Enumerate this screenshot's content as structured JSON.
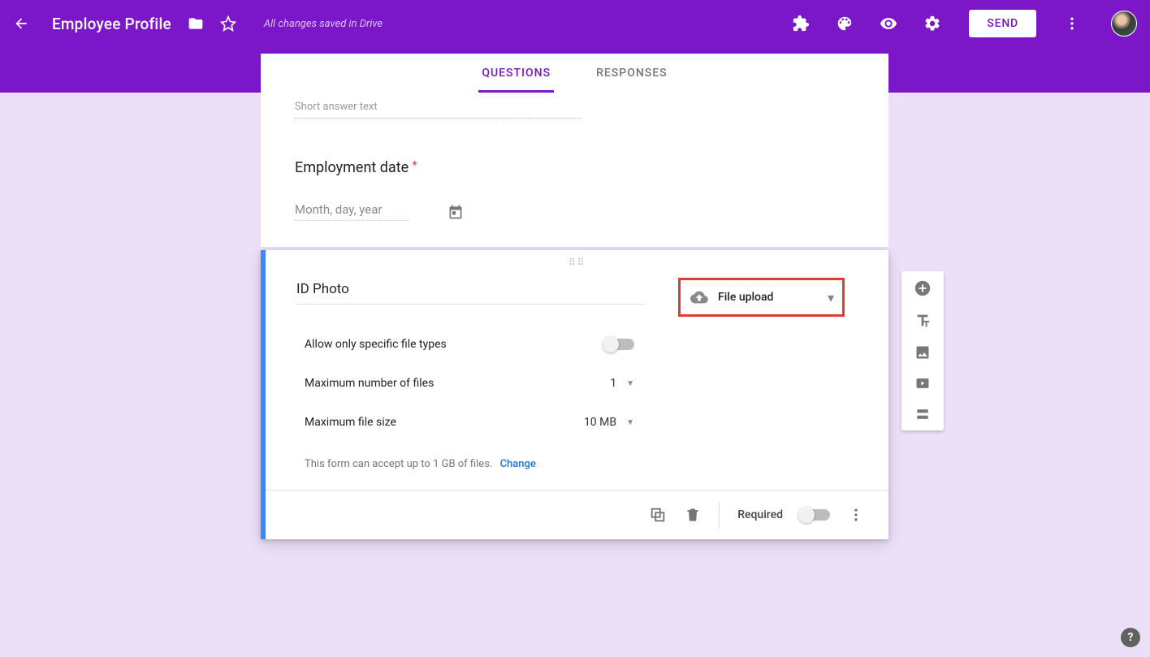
{
  "header": {
    "title": "Employee Profile",
    "save_status": "All changes saved in Drive",
    "send_label": "SEND"
  },
  "tabs": {
    "questions": "QUESTIONS",
    "responses": "RESPONSES"
  },
  "prev_question": {
    "short_answer_placeholder": "Short answer text"
  },
  "date_question": {
    "title": "Employment date",
    "required_mark": "*",
    "placeholder": "Month, day, year"
  },
  "selected_question": {
    "title": "ID Photo",
    "type_label": "File upload",
    "options": {
      "allow_specific_label": "Allow only specific file types",
      "max_files_label": "Maximum number of files",
      "max_files_value": "1",
      "max_size_label": "Maximum file size",
      "max_size_value": "10 MB"
    },
    "limit_text": "This form can accept up to 1 GB of files.",
    "change_label": "Change",
    "footer": {
      "required_label": "Required"
    }
  },
  "help_label": "?"
}
